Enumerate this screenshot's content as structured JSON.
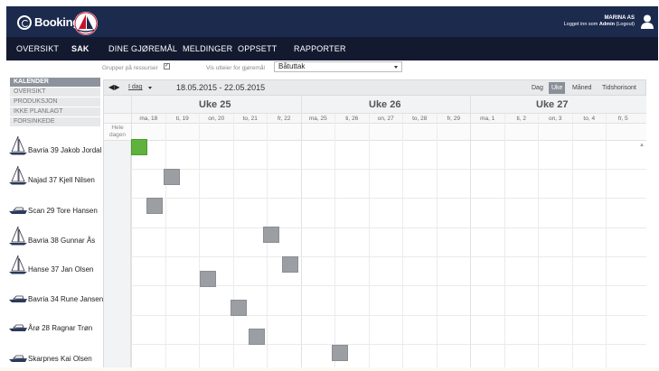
{
  "brand": {
    "name": "Booking"
  },
  "account": {
    "company": "MARINA AS",
    "logged_in_prefix": "Logget inn som",
    "user": "Admin",
    "logout": "(Logout)"
  },
  "nav": [
    {
      "label": "OVERSIKT",
      "active": false
    },
    {
      "label": "SAK",
      "active": true
    },
    {
      "label": "DINE GJØREMÅL",
      "active": false
    },
    {
      "label": "MELDINGER",
      "active": false
    },
    {
      "label": "OPPSETT",
      "active": false
    },
    {
      "label": "RAPPORTER",
      "active": false
    }
  ],
  "leftmenu": [
    {
      "label": "KALENDER",
      "type": "header"
    },
    {
      "label": "OVERSIKT",
      "type": "sub"
    },
    {
      "label": "PRODUKSJON",
      "type": "sub"
    },
    {
      "label": "IKKE PLANLAGT",
      "type": "sub"
    },
    {
      "label": "FORSINKEDE",
      "type": "sub"
    }
  ],
  "filters": {
    "group_by_resources_label": "Grupper på ressurser",
    "group_by_resources_checked": "✓",
    "show_tasks_label": "Vis utleier for gjøremål",
    "selected_task": "Båtuttak"
  },
  "toolbar": {
    "arrows": "◀ ▶",
    "today": "I dag",
    "date_range": "18.05.2015 - 22.05.2015",
    "views": [
      {
        "label": "Dag",
        "active": false
      },
      {
        "label": "Uke",
        "active": true
      },
      {
        "label": "Måned",
        "active": false
      },
      {
        "label": "Tidshorisont",
        "active": false
      }
    ]
  },
  "calendar": {
    "allday_label": "Hele dagen",
    "weeks": [
      "Uke 25",
      "Uke 26",
      "Uke 27"
    ],
    "days": [
      "ma, 18",
      "ti, 19",
      "on, 20",
      "to, 21",
      "fr, 22",
      "ma, 25",
      "ti, 26",
      "on, 27",
      "to, 28",
      "fr, 29",
      "ma, 1",
      "ti, 2",
      "on, 3",
      "to, 4",
      "fr, 5"
    ]
  },
  "resources": [
    {
      "boat": "Bavria 39",
      "owner": "Jakob Jordal",
      "icon": "sailboat-icon"
    },
    {
      "boat": "Najad 37",
      "owner": "Kjell Nilsen",
      "icon": "sailboat-icon"
    },
    {
      "boat": "Scan 29",
      "owner": "Tore Hansen",
      "icon": "motorboat-icon"
    },
    {
      "boat": "Bavria 38",
      "owner": "Gunnar Ås",
      "icon": "sailboat-icon"
    },
    {
      "boat": "Hanse 37",
      "owner": "Jan Olsen",
      "icon": "sailboat-icon"
    },
    {
      "boat": "Bavria 34",
      "owner": "Rune Jansen",
      "icon": "motorboat-icon"
    },
    {
      "boat": "Årø 28",
      "owner": "Ragnar Trøn",
      "icon": "motorboat-icon"
    },
    {
      "boat": "Skarpnes",
      "owner": "Kai Olsen",
      "icon": "motorboat-icon"
    }
  ],
  "colors": {
    "topbar": "#1c2a4e",
    "navbar": "#131a30",
    "event_default": "#9b9ea2",
    "event_highlight": "#5fb23b"
  }
}
